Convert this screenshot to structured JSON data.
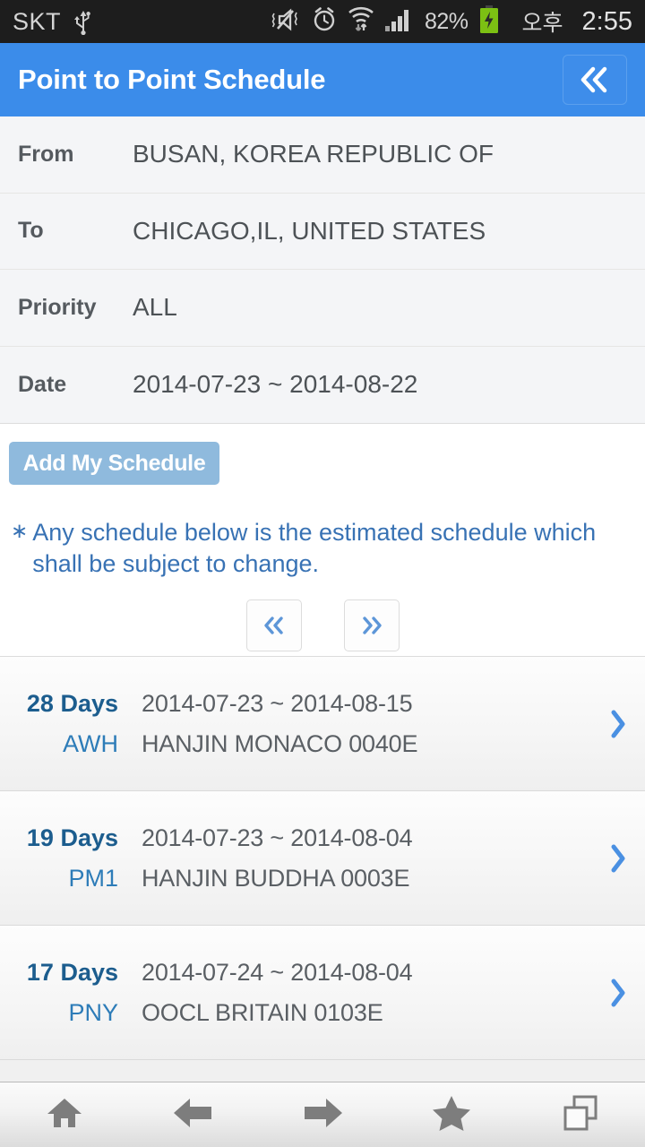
{
  "statusbar": {
    "carrier": "SKT",
    "usb_icon": "usb-icon",
    "mute_icon": "vibrate-mute-icon",
    "alarm_icon": "alarm-clock-icon",
    "wifi_icon": "wifi-icon",
    "signal_icon": "cellular-signal-icon",
    "battery_percent": "82%",
    "battery_icon": "battery-charging-icon",
    "ampm": "오후",
    "time": "2:55"
  },
  "titlebar": {
    "title": "Point to Point Schedule",
    "back_label": "«",
    "bg_color": "#3b8cea"
  },
  "form": {
    "rows": [
      {
        "label": "From",
        "value": "BUSAN, KOREA REPUBLIC OF"
      },
      {
        "label": "To",
        "value": "CHICAGO,IL, UNITED STATES"
      },
      {
        "label": "Priority",
        "value": "ALL"
      },
      {
        "label": "Date",
        "value": "2014-07-23 ~ 2014-08-22"
      }
    ]
  },
  "actions": {
    "add_schedule_label": "Add My Schedule",
    "add_schedule_color": "#8fbadd"
  },
  "notice": {
    "marker": "∗",
    "text": "Any schedule below is the estimated schedule which shall be subject to change.",
    "color": "#3872b4"
  },
  "pager": {
    "prev_label": "«",
    "next_label": "»",
    "accent_color": "#5d96d8"
  },
  "schedules": [
    {
      "days": "28 Days",
      "code": "AWH",
      "dates": "2014-07-23 ~ 2014-08-15",
      "vessel": "HANJIN MONACO 0040E"
    },
    {
      "days": "19 Days",
      "code": "PM1",
      "dates": "2014-07-23 ~ 2014-08-04",
      "vessel": "HANJIN BUDDHA 0003E"
    },
    {
      "days": "17 Days",
      "code": "PNY",
      "dates": "2014-07-24 ~ 2014-08-04",
      "vessel": "OOCL BRITAIN 0103E"
    }
  ],
  "bottomnav": {
    "items": [
      {
        "name": "home-icon"
      },
      {
        "name": "back-arrow-icon"
      },
      {
        "name": "forward-arrow-icon"
      },
      {
        "name": "star-icon"
      },
      {
        "name": "windows-icon"
      }
    ]
  }
}
